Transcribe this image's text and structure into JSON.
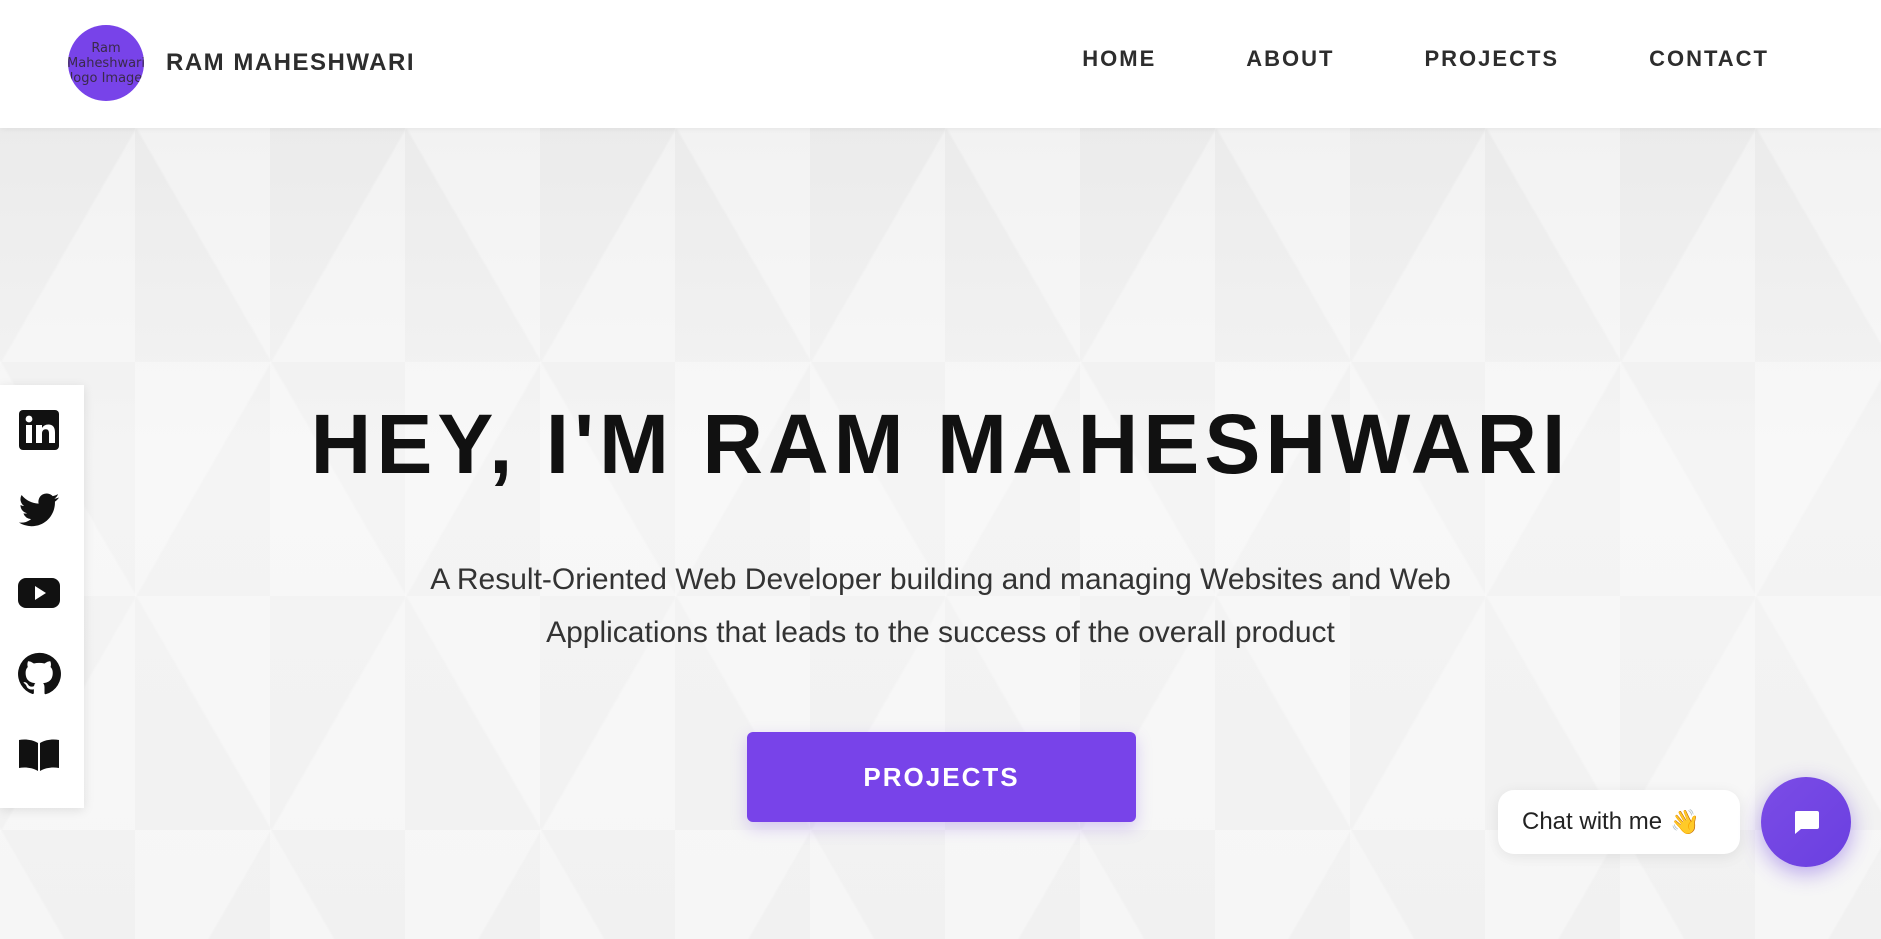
{
  "header": {
    "logo_alt": "Ram Maheshwari logo Image",
    "brand_name": "RAM MAHESHWARI",
    "nav": [
      {
        "label": "HOME"
      },
      {
        "label": "ABOUT"
      },
      {
        "label": "PROJECTS"
      },
      {
        "label": "CONTACT"
      }
    ]
  },
  "hero": {
    "title": "HEY, I'M RAM MAHESHWARI",
    "subtitle_line1": "A Result-Oriented Web Developer building and managing Websites and Web",
    "subtitle_line2": "Applications that leads to the success of the overall product",
    "cta_label": "PROJECTS"
  },
  "social": {
    "icons": [
      "linkedin-icon",
      "twitter-icon",
      "youtube-icon",
      "github-icon",
      "book-icon"
    ]
  },
  "chat": {
    "bubble_text": "Chat with me",
    "bubble_emoji": "👋"
  },
  "colors": {
    "accent": "#7843e9",
    "text_dark": "#111111",
    "header_bg": "#ffffff",
    "hero_bg": "#f2f2f2"
  }
}
